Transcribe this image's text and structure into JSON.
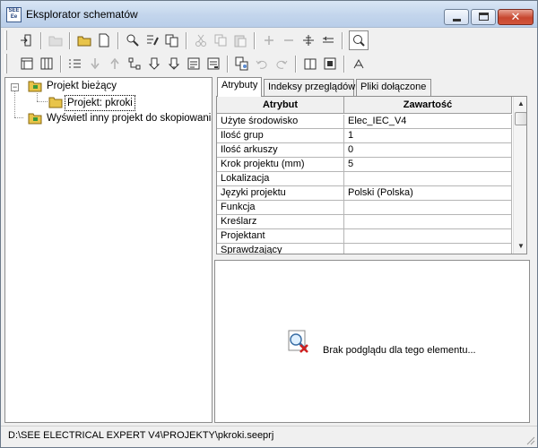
{
  "window": {
    "title": "Eksplorator schematów",
    "app_icon_text": "SEE Ee",
    "close_glyph": "✕"
  },
  "tree": {
    "items": [
      {
        "label": "Projekt bieżący",
        "expander": "−"
      },
      {
        "label": "Projekt: pkroki"
      },
      {
        "label": "Wyświetl inny projekt do skopiowania"
      }
    ]
  },
  "tabs": [
    {
      "label": "Atrybuty"
    },
    {
      "label": "Indeksy przeglądów"
    },
    {
      "label": "Pliki dołączone"
    }
  ],
  "grid": {
    "headers": [
      "Atrybut",
      "Zawartość"
    ],
    "rows": [
      {
        "attr": "Użyte środowisko",
        "value": "Elec_IEC_V4"
      },
      {
        "attr": "Ilość grup",
        "value": "1"
      },
      {
        "attr": "Ilość arkuszy",
        "value": "0"
      },
      {
        "attr": "Krok projektu (mm)",
        "value": "5"
      },
      {
        "attr": "Lokalizacja",
        "value": ""
      },
      {
        "attr": "Języki projektu",
        "value": "Polski (Polska)"
      },
      {
        "attr": "Funkcja",
        "value": ""
      },
      {
        "attr": "Kreślarz",
        "value": ""
      },
      {
        "attr": "Projektant",
        "value": ""
      },
      {
        "attr": "Sprawdzający",
        "value": ""
      }
    ]
  },
  "preview": {
    "message": "Brak podglądu dla tego elementu..."
  },
  "status": {
    "path": "D:\\SEE ELECTRICAL EXPERT V4\\PROJEKTY\\pkroki.seeprj"
  },
  "colors": {
    "folder": "#e8c44a",
    "title_gradient_top": "#d9e6f5",
    "close_button": "#c7472f"
  }
}
